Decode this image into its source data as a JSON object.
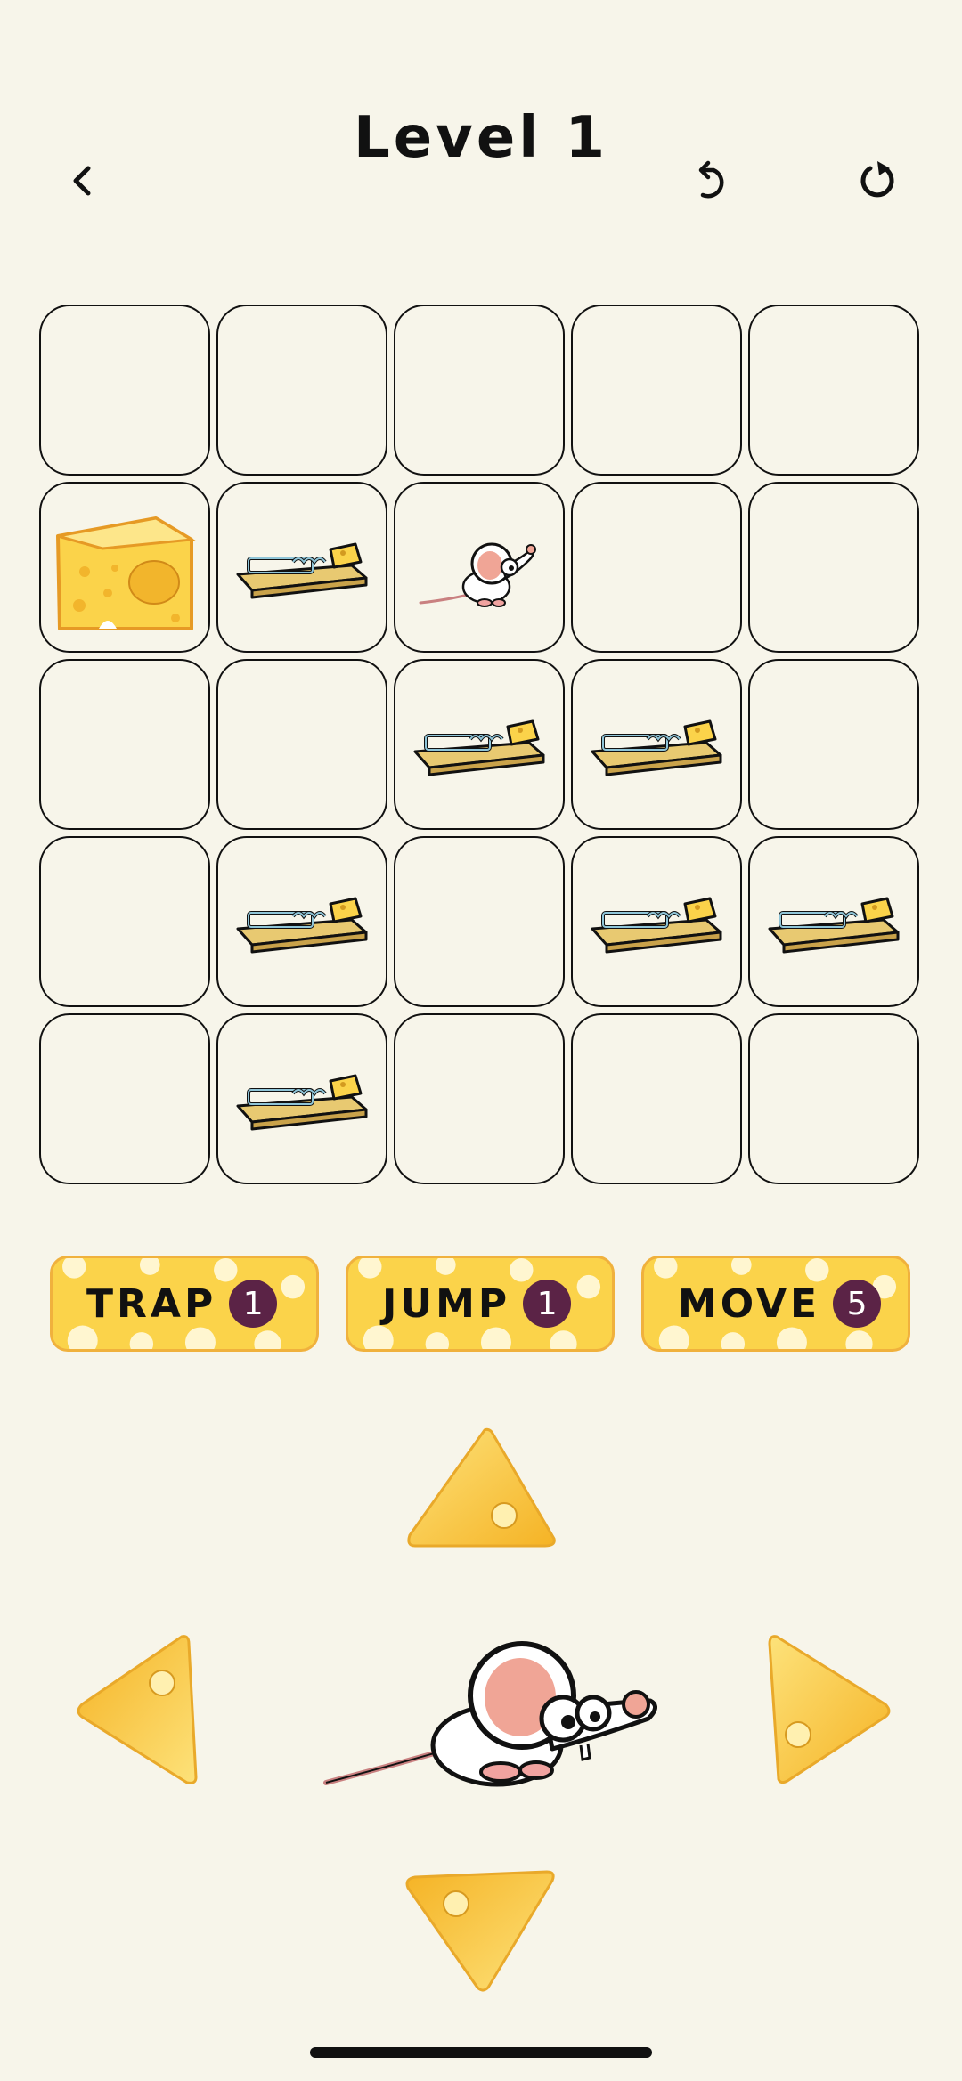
{
  "header": {
    "title": "Level 1"
  },
  "icons": {
    "back": "chevron-left-icon",
    "undo": "undo-icon",
    "restart": "restart-icon"
  },
  "board": {
    "rows": [
      [
        "empty",
        "empty",
        "empty",
        "empty",
        "empty"
      ],
      [
        "cheese",
        "trap",
        "mouse",
        "empty",
        "empty"
      ],
      [
        "empty",
        "empty",
        "trap",
        "trap",
        "empty"
      ],
      [
        "empty",
        "trap",
        "empty",
        "trap",
        "trap"
      ],
      [
        "empty",
        "trap",
        "empty",
        "empty",
        "empty"
      ]
    ]
  },
  "powers": [
    {
      "label": "TRAP",
      "count": "1"
    },
    {
      "label": "JUMP",
      "count": "1"
    },
    {
      "label": "MOVE",
      "count": "5"
    }
  ],
  "controls": [
    "up",
    "left",
    "right",
    "down"
  ],
  "colors": {
    "background": "#f7f5ea",
    "cheese": "#fbd34a",
    "badge": "#5b2346"
  }
}
